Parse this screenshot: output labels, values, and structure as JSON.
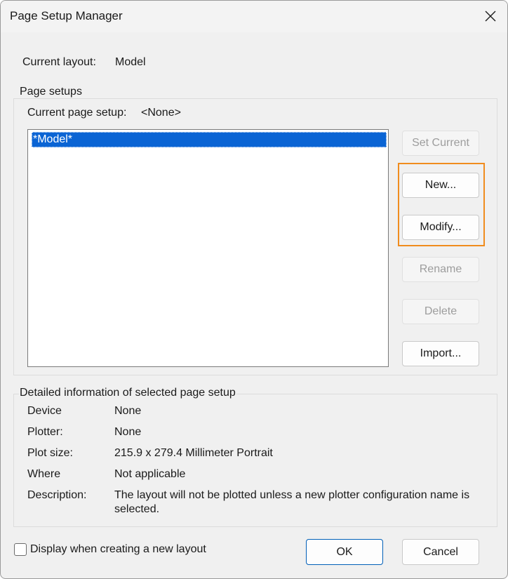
{
  "window": {
    "title": "Page Setup Manager"
  },
  "current_layout": {
    "label": "Current layout:",
    "value": "Model"
  },
  "page_setups": {
    "group_title": "Page setups",
    "current_label": "Current page setup:",
    "current_value": "<None>",
    "list_items": [
      "*Model*"
    ],
    "buttons": {
      "set_current": "Set Current",
      "new": "New...",
      "modify": "Modify...",
      "rename": "Rename",
      "delete": "Delete",
      "import": "Import..."
    }
  },
  "details": {
    "group_title": "Detailed information of selected page setup",
    "device_label": "Device",
    "device_value": "None",
    "plotter_label": "Plotter:",
    "plotter_value": "None",
    "plotsize_label": "Plot size:",
    "plotsize_value": "215.9 x 279.4 Millimeter Portrait",
    "where_label": "Where",
    "where_value": "Not applicable",
    "description_label": "Description:",
    "description_line1": "The layout will not be plotted unless a new plotter configuration name is",
    "description_line2": "selected."
  },
  "footer": {
    "checkbox_label": "Display when creating a new layout",
    "checkbox_checked": false,
    "ok": "OK",
    "cancel": "Cancel"
  },
  "colors": {
    "selection": "#0a64d4",
    "highlight": "#f08c1e",
    "ok_border": "#005fb8"
  }
}
